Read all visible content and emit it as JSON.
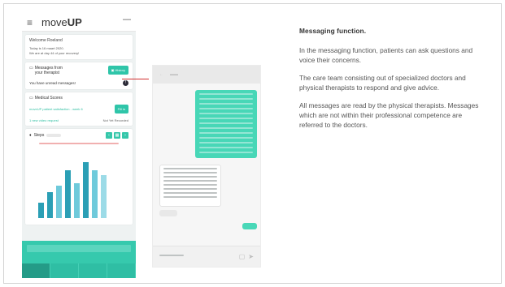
{
  "app": {
    "menu_icon": "hamburger-menu-icon",
    "logo_prefix": "move",
    "logo_bold": "UP"
  },
  "welcome": {
    "greeting": "Welcome Roeland",
    "line1": "Today is 16 maart 2020.",
    "line2": "We are at day 44 of your recovery!"
  },
  "messages": {
    "title": "Messages from your therapist",
    "button": "History",
    "unread": "You have unread messages!",
    "badge": "!"
  },
  "medical": {
    "title": "Medical Scores",
    "survey": "moveUP patient satisfaction - week 6",
    "fill_button": "Fill in",
    "video": "1 new video request",
    "video_status": "Not Yet Recorded"
  },
  "steps": {
    "title": "Steps"
  },
  "chart_data": {
    "type": "bar",
    "title": "Steps",
    "values": [
      14,
      24,
      30,
      44,
      32,
      52,
      44,
      40
    ],
    "colors": [
      "#2b9fb5",
      "#2b9fb5",
      "#6fcadb",
      "#2b9fb5",
      "#6fcadb",
      "#2b9fb5",
      "#6fcadb",
      "#9cdbe7"
    ]
  },
  "description": {
    "heading": "Messaging function.",
    "paragraphs": [
      "In the messaging function, patients can ask questions and voice their concerns.",
      "The care team consisting out of specialized doctors and physical therapists to respond and give advice.",
      "All messages are read by the physical therapists.  Messages which are not within their professional competence are referred to the doctors."
    ]
  },
  "colors": {
    "accent": "#35c7aa",
    "connector": "#d22f2f"
  }
}
